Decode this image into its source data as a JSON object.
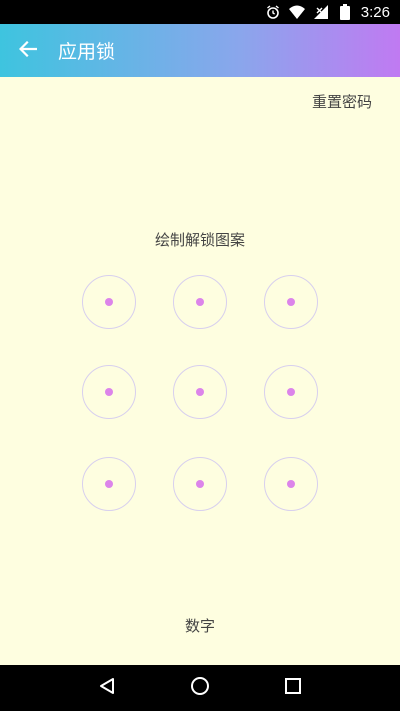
{
  "status_bar": {
    "time": "3:26",
    "icons": [
      "alarm-icon",
      "wifi-icon",
      "signal-icon",
      "battery-icon"
    ]
  },
  "app_bar": {
    "back_icon": "arrow-left-icon",
    "title": "应用锁"
  },
  "reset_label": "重置密码",
  "prompt": "绘制解锁图案",
  "pattern_nodes": [
    1,
    2,
    3,
    4,
    5,
    6,
    7,
    8,
    9
  ],
  "colors": {
    "background": "#fefee0",
    "gradient_start": "#3ec4df",
    "gradient_end": "#c07af2",
    "node_ring": "#d7cfee",
    "node_dot": "#dc84ea"
  },
  "numeric_label": "数字",
  "nav_bar": {
    "icons": [
      "back-triangle-icon",
      "home-circle-icon",
      "recents-square-icon"
    ]
  }
}
